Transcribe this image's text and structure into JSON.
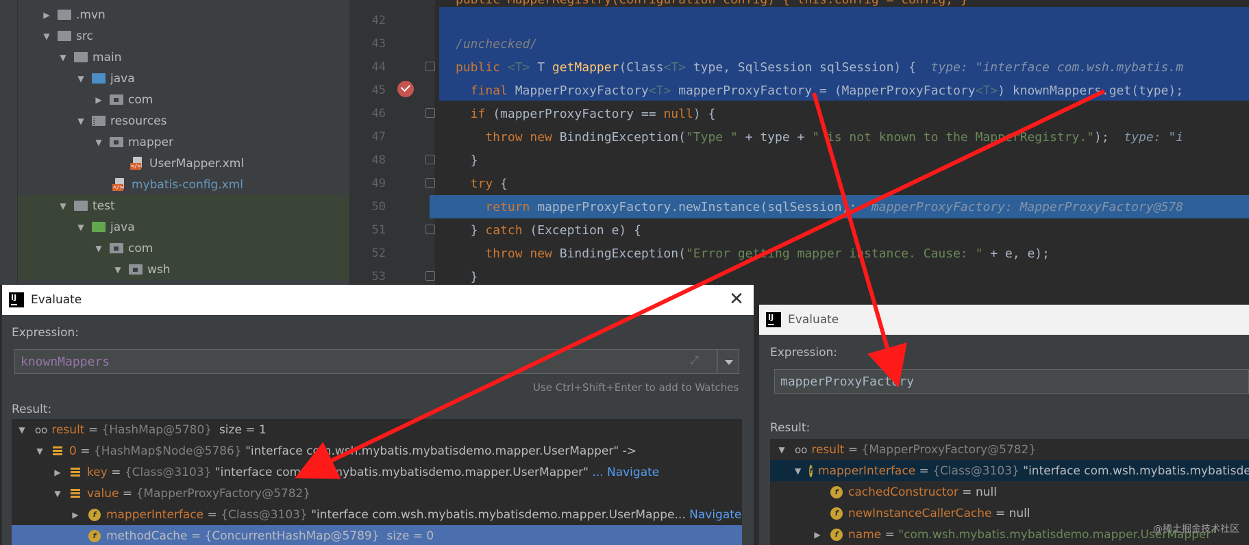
{
  "tree": {
    "items": [
      {
        "label": ".mvn",
        "indent": 1,
        "arrow": "▶",
        "kind": "folder"
      },
      {
        "label": "src",
        "indent": 1,
        "arrow": "▼",
        "kind": "folder"
      },
      {
        "label": "main",
        "indent": 2,
        "arrow": "▼",
        "kind": "folder"
      },
      {
        "label": "java",
        "indent": 3,
        "arrow": "▼",
        "kind": "folder-blue"
      },
      {
        "label": "com",
        "indent": 4,
        "arrow": "▶",
        "kind": "pkg"
      },
      {
        "label": "resources",
        "indent": 3,
        "arrow": "▼",
        "kind": "res"
      },
      {
        "label": "mapper",
        "indent": 4,
        "arrow": "▼",
        "kind": "pkg"
      },
      {
        "label": "UserMapper.xml",
        "indent": 5,
        "arrow": "",
        "kind": "xml"
      },
      {
        "label": "mybatis-config.xml",
        "indent": 4,
        "arrow": "",
        "kind": "xml-blue"
      },
      {
        "label": "test",
        "indent": 2,
        "arrow": "▼",
        "kind": "folder"
      },
      {
        "label": "java",
        "indent": 3,
        "arrow": "▼",
        "kind": "folder-green"
      },
      {
        "label": "com",
        "indent": 4,
        "arrow": "▼",
        "kind": "pkg"
      },
      {
        "label": "wsh",
        "indent": 5,
        "arrow": "▼",
        "kind": "pkg"
      }
    ]
  },
  "editor": {
    "lines": [
      "42",
      "43",
      "44",
      "45",
      "46",
      "47",
      "48",
      "49",
      "50",
      "51",
      "52",
      "53"
    ],
    "code": {
      "l41": "public MapperRegistry(Configuration config) { this.config = config; }",
      "l43": "/unchecked/",
      "l44_a": "public ",
      "l44_b": "<T>",
      "l44_c": " T ",
      "l44_d": "getMapper",
      "l44_e": "(Class",
      "l44_f": "<T>",
      "l44_g": " type, SqlSession sqlSession) {  ",
      "l44_hint": "type: \"interface com.wsh.mybatis.m",
      "l45_a": "  final ",
      "l45_b": "MapperProxyFactory",
      "l45_c": "<T>",
      "l45_d": " mapperProxyFactory = (MapperProxyFactory",
      "l45_e": "<T>",
      "l45_f": ") knownMappers.get(type);",
      "l46_a": "  if ",
      "l46_b": "(mapperProxyFactory == ",
      "l46_c": "null",
      "l46_d": ") {",
      "l47_a": "    throw new ",
      "l47_b": "BindingException(",
      "l47_c": "\"Type \"",
      "l47_d": " + type + ",
      "l47_e": "\" is not known to the MapperRegistry.\"",
      "l47_f": ");  ",
      "l47_hint": "type: \"i",
      "l48": "  }",
      "l49_a": "  try ",
      "l49_b": "{",
      "l50_a": "    return ",
      "l50_b": "mapperProxyFactory.newInstance(sqlSession);  ",
      "l50_hint": "mapperProxyFactory: MapperProxyFactory@578",
      "l51_a": "  } ",
      "l51_b": "catch ",
      "l51_c": "(Exception e) {",
      "l52_a": "    throw new ",
      "l52_b": "BindingException(",
      "l52_c": "\"Error getting mapper instance. Cause: \"",
      "l52_d": " + e, e);",
      "l53": "  }"
    }
  },
  "dialog1": {
    "title": "Evaluate",
    "expression_label": "Expression:",
    "expression": "knownMappers",
    "hint": "Use Ctrl+Shift+Enter to add to Watches",
    "result_label": "Result:",
    "rows": [
      {
        "name": "result",
        "ref": "{HashMap@5780}",
        "val": "size = 1"
      },
      {
        "name": "0",
        "ref": "{HashMap$Node@5786}",
        "val": "\"interface com.wsh.mybatis.mybatisdemo.mapper.UserMapper\" ->"
      },
      {
        "name": "key",
        "ref": "{Class@3103}",
        "val": "\"interface com.wsh.mybatis.mybatisdemo.mapper.UserMapper\"",
        "nav": "... Navigate"
      },
      {
        "name": "value",
        "ref": "{MapperProxyFactory@5782}",
        "val": ""
      },
      {
        "name": "mapperInterface",
        "ref": "{Class@3103}",
        "val": "\"interface com.wsh.mybatis.mybatisdemo.mapper.UserMappe...",
        "nav": "Navigate"
      },
      {
        "name": "methodCache",
        "ref": "{ConcurrentHashMap@5789}",
        "val": "size = 0"
      }
    ]
  },
  "dialog2": {
    "title": "Evaluate",
    "expression_label": "Expression:",
    "expression": "mapperProxyFactory",
    "result_label": "Result:",
    "rows": [
      {
        "name": "result",
        "ref": "{MapperProxyFactory@5782}",
        "val": ""
      },
      {
        "name": "mapperInterface",
        "ref": "{Class@3103}",
        "val": "\"interface com.wsh.mybatis.mybatisde"
      },
      {
        "name": "cachedConstructor",
        "ref": "",
        "val": "null"
      },
      {
        "name": "newInstanceCallerCache",
        "ref": "",
        "val": "null"
      },
      {
        "name": "name",
        "ref": "",
        "val": "\"com.wsh.mybatis.mybatisdemo.mapper.UserMapper\""
      }
    ]
  },
  "watermark": "@稀土掘金技术社区",
  "colors": {
    "arrow": "#ff1a1a",
    "selection": "#214283",
    "current_line": "#2d6099"
  }
}
